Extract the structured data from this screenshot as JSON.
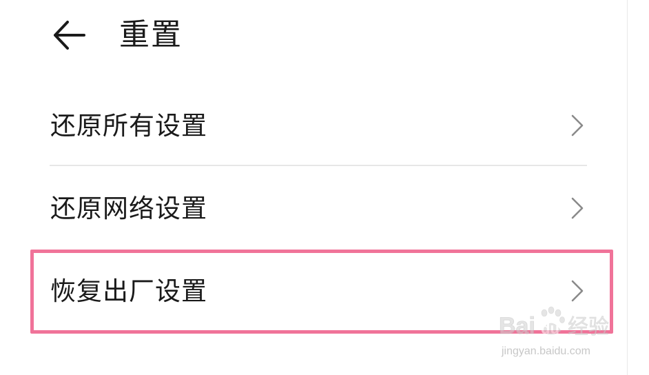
{
  "header": {
    "back_icon": "arrow-left-icon",
    "title": "重置"
  },
  "menu": {
    "items": [
      {
        "label": "还原所有设置",
        "icon": "chevron-right-icon",
        "highlighted": false
      },
      {
        "label": "还原网络设置",
        "icon": "chevron-right-icon",
        "highlighted": false
      },
      {
        "label": "恢复出厂设置",
        "icon": "chevron-right-icon",
        "highlighted": true
      }
    ]
  },
  "annotation": {
    "highlight_color": "#f07399"
  },
  "watermark": {
    "logo_text": "Baidu 经验",
    "url": "jingyan.baidu.com"
  }
}
